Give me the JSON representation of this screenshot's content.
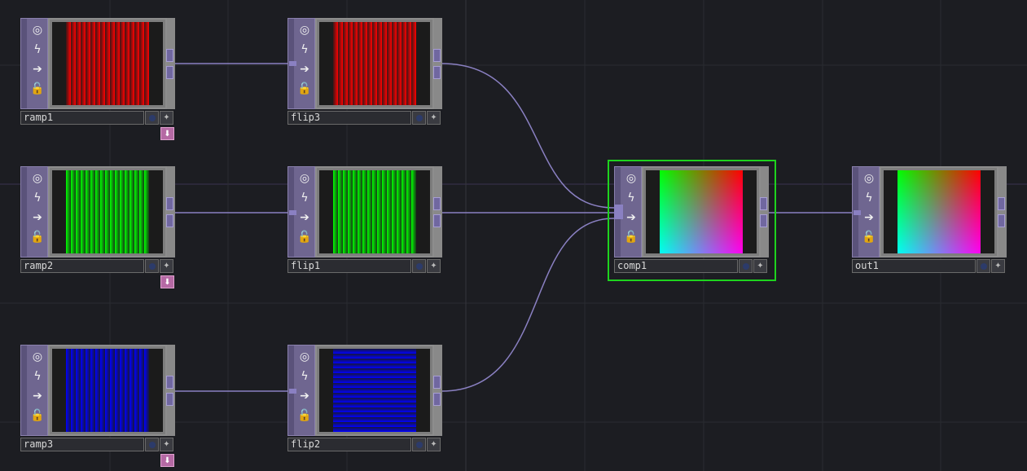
{
  "network": {
    "colors": {
      "background": "#1c1d22",
      "wire": "#8a80c2",
      "selection": "#1ed31e",
      "viewer_flag": "#b569a4"
    },
    "sidebar_icons": [
      "viewer-toggle-icon",
      "bypass-icon",
      "display-icon",
      "lock-icon"
    ],
    "nodes": [
      {
        "name": "ramp1",
        "image": "red-ramp-horizontal",
        "viewer_flag": true
      },
      {
        "name": "flip3",
        "image": "red-ramp-horizontal",
        "viewer_flag": false
      },
      {
        "name": "ramp2",
        "image": "green-ramp-horizontal",
        "viewer_flag": true
      },
      {
        "name": "flip1",
        "image": "green-ramp-horizontal",
        "viewer_flag": false
      },
      {
        "name": "ramp3",
        "image": "blue-ramp-horizontal",
        "viewer_flag": true
      },
      {
        "name": "flip2",
        "image": "blue-ramp-vertical",
        "viewer_flag": false
      },
      {
        "name": "comp1",
        "image": "rgb-composite",
        "viewer_flag": false,
        "selected": true
      },
      {
        "name": "out1",
        "image": "rgb-composite",
        "viewer_flag": false
      }
    ],
    "connections": [
      [
        "ramp1",
        "flip3"
      ],
      [
        "ramp2",
        "flip1"
      ],
      [
        "ramp3",
        "flip2"
      ],
      [
        "flip3",
        "comp1"
      ],
      [
        "flip1",
        "comp1"
      ],
      [
        "flip2",
        "comp1"
      ],
      [
        "comp1",
        "out1"
      ]
    ]
  }
}
